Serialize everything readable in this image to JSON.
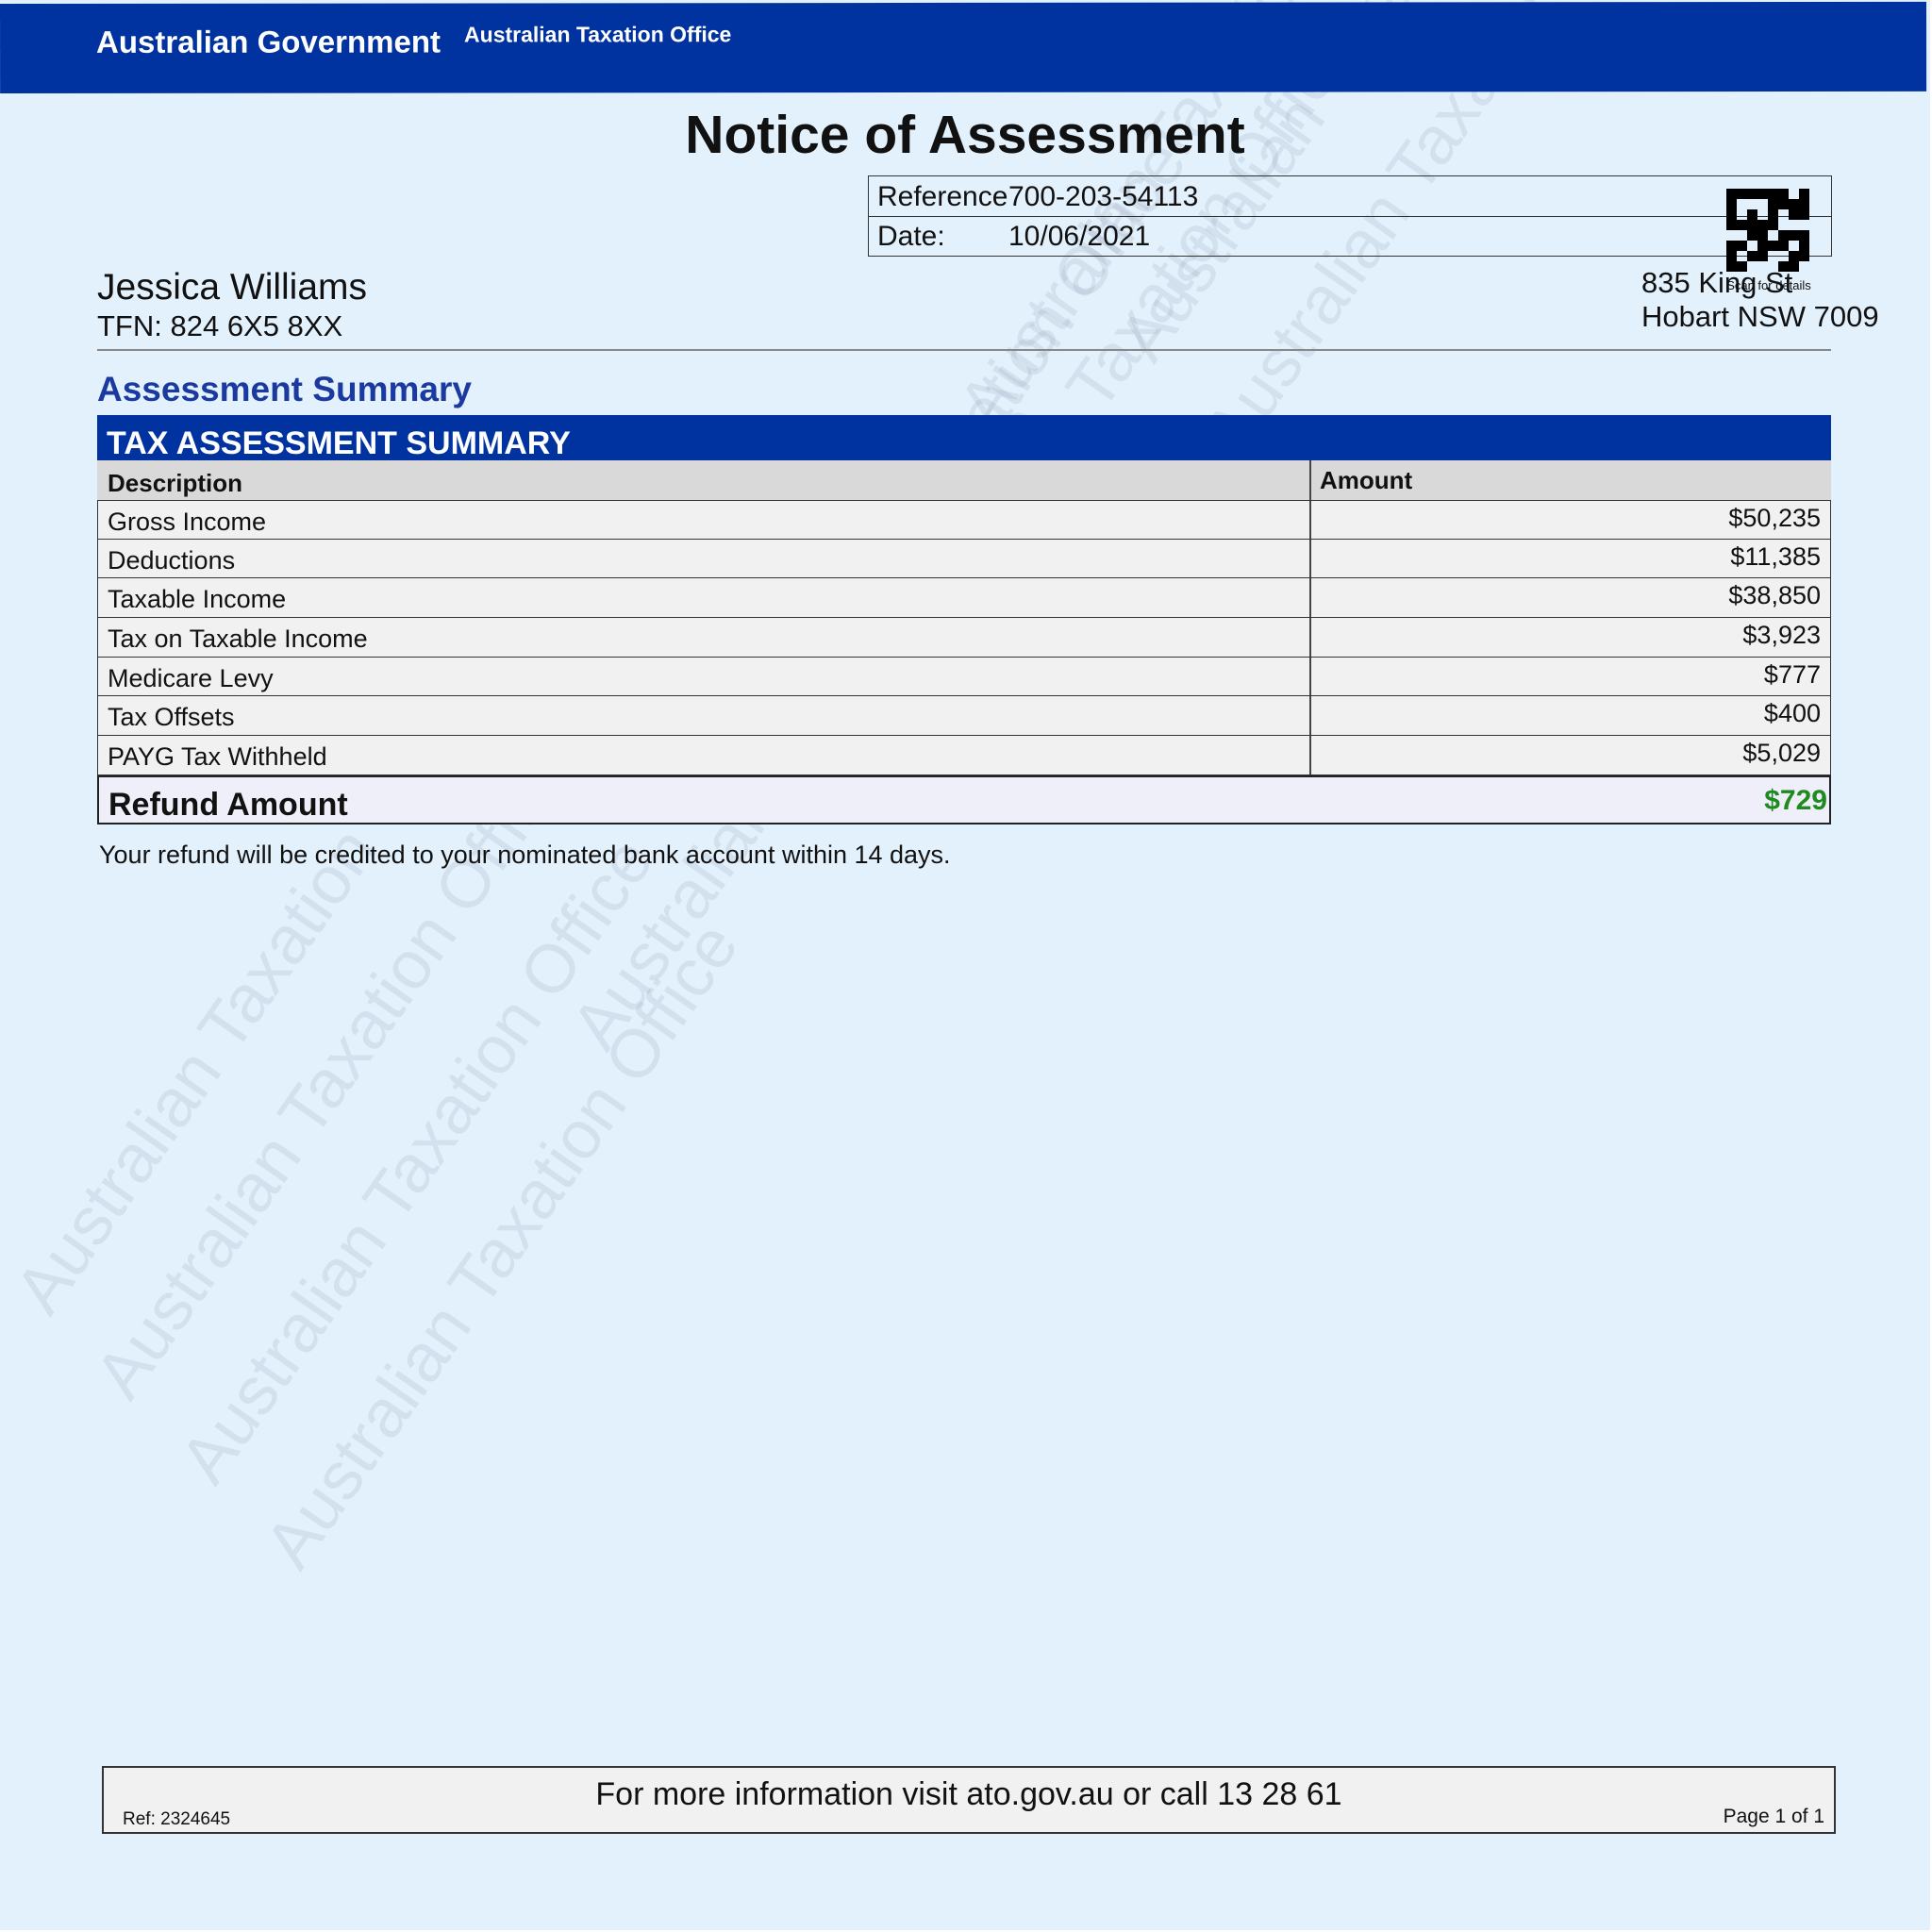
{
  "header": {
    "government": "Australian Government",
    "agency": "Australian Taxation Office"
  },
  "watermark": {
    "text": "Australian Taxation Office"
  },
  "document": {
    "title": "Notice of Assessment"
  },
  "reference": {
    "ref_label": "Reference",
    "ref_value": "700-203-54113",
    "date_label": "Date:",
    "date_value": "10/06/2021"
  },
  "qr": {
    "caption": "Scan for details"
  },
  "taxpayer": {
    "name": "Jessica Williams",
    "tfn": "TFN: 824 6X5 8XX",
    "address_line1": "835 King St",
    "address_line2": "Hobart NSW 7009"
  },
  "section_title": "Assessment Summary",
  "table": {
    "title": "TAX ASSESSMENT SUMMARY",
    "columns": [
      "Description",
      "Amount"
    ],
    "rows": [
      {
        "description": "Gross Income",
        "amount": "$50,235"
      },
      {
        "description": "Deductions",
        "amount": "$11,385"
      },
      {
        "description": "Taxable Income",
        "amount": "$38,850"
      },
      {
        "description": "Tax on Taxable Income",
        "amount": "$3,923"
      },
      {
        "description": "Medicare Levy",
        "amount": "$777"
      },
      {
        "description": "Tax Offsets",
        "amount": "$400"
      },
      {
        "description": "PAYG Tax Withheld",
        "amount": "$5,029"
      }
    ],
    "total": {
      "label": "Refund Amount",
      "amount": "$729",
      "color": "#1f8a1f"
    }
  },
  "note": "Your refund will be credited to your nominated bank account within 14 days.",
  "footer": {
    "message": "For more information visit ato.gov.au or call 13 28 61",
    "ref": "Ref: 2324645",
    "page": "Page 1 of 1"
  },
  "colors": {
    "banner": "#0033a0",
    "background": "#e3f1fc",
    "section_title": "#1a3aa0"
  }
}
